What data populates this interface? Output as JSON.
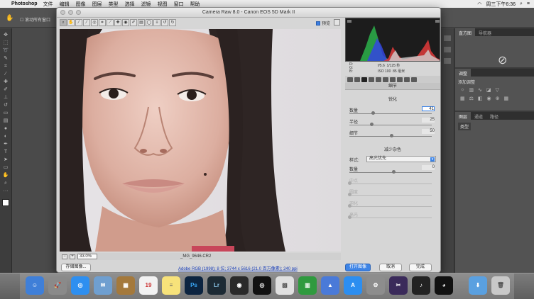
{
  "menubar": {
    "app": "Photoshop",
    "items": [
      "文件",
      "编辑",
      "图像",
      "图层",
      "类型",
      "选择",
      "滤镜",
      "视图",
      "窗口",
      "帮助"
    ],
    "clock": "周三下午6:36"
  },
  "ps_options": {
    "scroll_all": "滚动所有窗口"
  },
  "dialog": {
    "title": "Camera Raw 8.0 - Canon EOS 5D Mark II",
    "preview_label": "预览",
    "zoom": "33.0%",
    "filename": "_MG_9646.CR2",
    "workflow": "Adobe RGB (1998); 8 位; 3744 x 5616 (21.0 百万像素); 240 ppi",
    "buttons": {
      "save": "存储图像...",
      "open": "打开图像",
      "cancel": "取消",
      "done": "完成"
    }
  },
  "readout": {
    "r": "R:",
    "g": "G:",
    "b": "B:",
    "aperture": "f/5.6",
    "shutter": "1/125 秒",
    "iso": "ISO 100",
    "focal": "85 毫米"
  },
  "panel": {
    "header": "细节",
    "sharpen": {
      "title": "锐化",
      "sliders": [
        {
          "label": "数量",
          "value": "41",
          "pos": 0.27
        },
        {
          "label": "半径",
          "value": "25",
          "pos": 0.25
        },
        {
          "label": "细节",
          "value": "50",
          "pos": 0.5
        }
      ]
    },
    "noise": {
      "title": "减少杂色",
      "mode_label": "样式:",
      "mode_value": "高光优先",
      "amount_label": "数量",
      "amount_value": "0",
      "disabled_sliders": [
        "中点",
        "圆度",
        "羽化",
        "高光"
      ]
    }
  },
  "right_panels": {
    "tabs_top": [
      "直方图",
      "导航器"
    ],
    "adjust_tab": "调整",
    "adjust_sub": "添加调整",
    "layers_tabs": [
      "图层",
      "通道",
      "路径"
    ],
    "layer_kind": "类型"
  },
  "colors": {
    "accent": "#3d84e6",
    "dialog": "#d6d6d6",
    "ps_dark": "#535353"
  }
}
